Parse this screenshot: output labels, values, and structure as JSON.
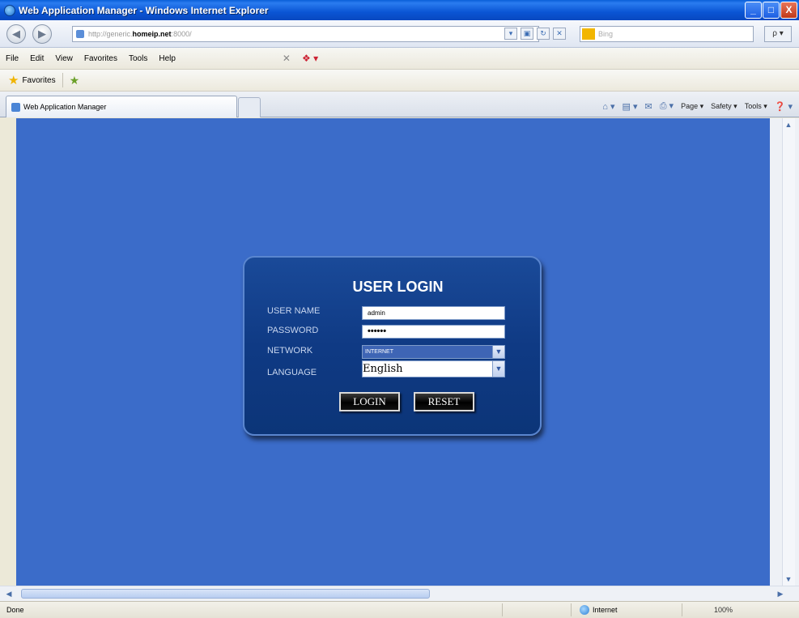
{
  "window": {
    "title": "Web Application Manager - Windows Internet Explorer",
    "buttons": [
      "_",
      "□",
      "X"
    ]
  },
  "addressbar": {
    "url_prefix": "http://generic.",
    "url_host": "homeip.net",
    "url_suffix": ":8000/",
    "search_placeholder": "Bing",
    "search_button": "ρ ▾"
  },
  "menu": {
    "items": [
      "File",
      "Edit",
      "View",
      "Favorites",
      "Tools",
      "Help"
    ]
  },
  "favorites": {
    "label": "Favorites"
  },
  "tab": {
    "label": "Web Application Manager"
  },
  "commandbar": {
    "page": "Page ▾",
    "safety": "Safety ▾",
    "tools": "Tools ▾"
  },
  "login": {
    "title": "USER LOGIN",
    "username_label": "USER NAME",
    "password_label": "PASSWORD",
    "network_label": "NETWORK",
    "language_label": "LANGUAGE",
    "username_value": "admin",
    "password_value": "••••••",
    "network_value": "INTERNET",
    "language_value": "English",
    "login_button": "LOGIN",
    "reset_button": "RESET"
  },
  "statusbar": {
    "status": "Done",
    "zone": "Internet",
    "zoom": "100%"
  },
  "colors": {
    "page_background": "#3b6cc9",
    "panel_background": "#0f3a84",
    "title_bar": "#0a55d4"
  }
}
